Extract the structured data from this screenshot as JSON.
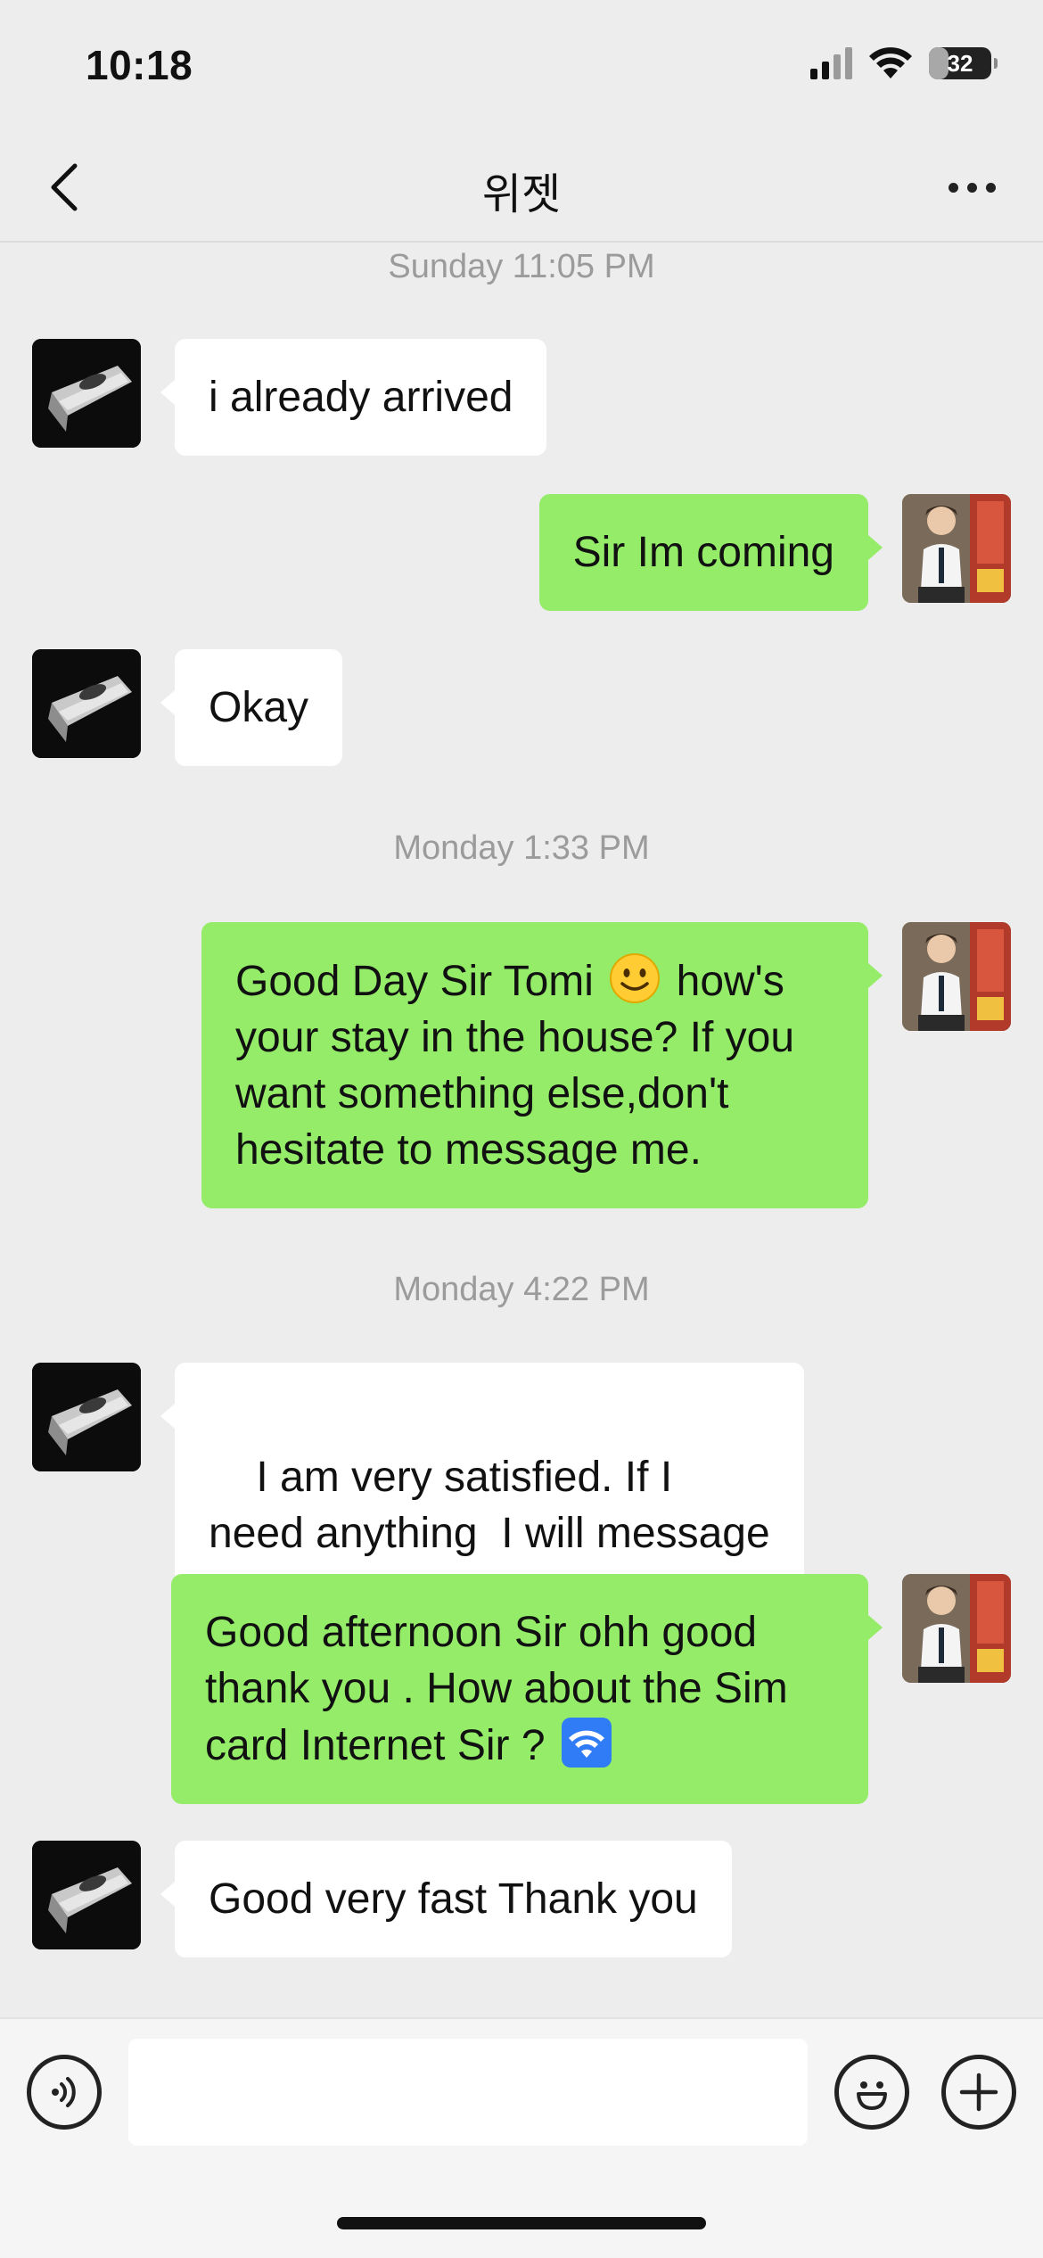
{
  "status_bar": {
    "time": "10:18",
    "battery": "32",
    "battery_level": 0.32,
    "icons": [
      "signal-icon",
      "wifi-icon",
      "battery-icon"
    ]
  },
  "nav": {
    "title": "위젯",
    "back_icon": "chevron-left-icon",
    "more_icon": "more-dots-icon"
  },
  "messages": [
    {
      "type": "timestamp",
      "text": "Sunday 11:05 PM"
    },
    {
      "type": "in",
      "text": "i already arrived"
    },
    {
      "type": "out",
      "text": "Sir Im coming"
    },
    {
      "type": "in",
      "text": "Okay"
    },
    {
      "type": "timestamp",
      "text": "Monday 1:33 PM"
    },
    {
      "type": "out",
      "line1_before": "Good Day Sir Tomi",
      "emoji": "smile-emoji",
      "line1_after": "how's",
      "rest": "your stay in the house? If you want something else,don't hesitate to message me."
    },
    {
      "type": "timestamp",
      "text": "Monday 4:22 PM"
    },
    {
      "type": "in",
      "text": "I am very satisfied. If I need anything  I will message you"
    },
    {
      "type": "out",
      "text_before": "Good afternoon Sir ohh good thank you . How about the Sim card Internet Sir ?",
      "emoji": "wifi-emoji"
    },
    {
      "type": "in",
      "text": "Good very fast Thank you"
    }
  ],
  "input_bar": {
    "placeholder": "",
    "voice_icon": "voice-icon",
    "emoji_icon": "emoji-icon",
    "plus_icon": "plus-icon"
  },
  "colors": {
    "background": "#ededed",
    "bubble_out": "#95ec69",
    "bubble_in": "#ffffff",
    "timestamp": "#9b9b9b"
  }
}
